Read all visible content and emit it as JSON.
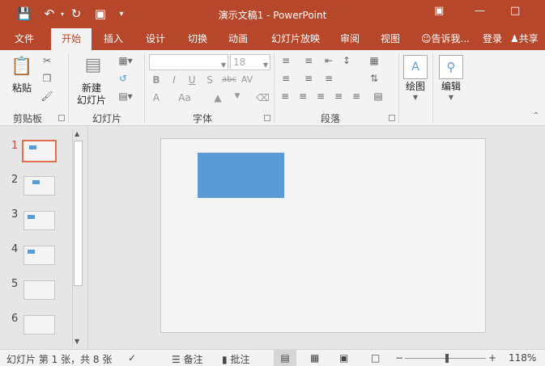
{
  "window": {
    "title": "演示文稿1 - PowerPoint"
  },
  "tabs": [
    "文件",
    "开始",
    "插入",
    "设计",
    "切换",
    "动画",
    "幻灯片放映",
    "审阅",
    "视图"
  ],
  "tell_me": "告诉我...",
  "sign_in": "登录",
  "share": "共享",
  "ribbon": {
    "clipboard": {
      "paste": "粘贴",
      "group": "剪贴板"
    },
    "slides": {
      "new_slide_line1": "新建",
      "new_slide_line2": "幻灯片",
      "group": "幻灯片"
    },
    "font": {
      "font_size": "18",
      "bold": "B",
      "italic": "I",
      "underline": "U",
      "shadow": "S",
      "strike": "abc",
      "spacing": "AV",
      "font_color": "A",
      "case": "Aa",
      "group": "字体"
    },
    "paragraph": {
      "group": "段落"
    },
    "drawing": {
      "label": "绘图"
    },
    "editing": {
      "label": "编辑"
    }
  },
  "thumbnails": [
    {
      "num": "1",
      "selected": true
    },
    {
      "num": "2",
      "selected": false
    },
    {
      "num": "3",
      "selected": false
    },
    {
      "num": "4",
      "selected": false
    },
    {
      "num": "5",
      "selected": false
    },
    {
      "num": "6",
      "selected": false
    }
  ],
  "status": {
    "slide_info": "幻灯片 第 1 张，共 8 张",
    "notes": "备注",
    "comments": "批注",
    "zoom": "118%"
  },
  "colors": {
    "accent": "#b7472a",
    "shape": "#5b9bd5",
    "selection": "#e06d4d"
  }
}
